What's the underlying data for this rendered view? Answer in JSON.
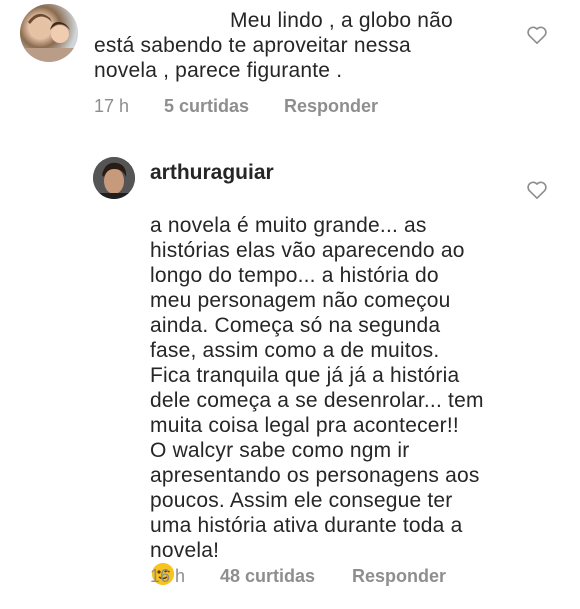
{
  "comments": [
    {
      "text": "Meu lindo , a globo não\nestá sabendo te aproveitar nessa\nnovela ,  parece figurante .",
      "time": "17 h",
      "likes": "5 curtidas",
      "reply": "Responder"
    },
    {
      "username": "arthuraguiar",
      "text": "a novela é muito grande... as\nhistórias elas vão aparecendo ao\nlongo do tempo... a história do\nmeu personagem não começou\nainda. Começa só na segunda\nfase, assim como a de muitos.\nFica tranquila que já já a história\ndele começa a se desenrolar... tem\nmuita coisa legal pra acontecer!!\nO walcyr sabe como ngm ir\napresentando os personagens aos\npoucos. Assim ele consegue ter\numa história ativa durante toda a\nnovela!",
      "time": "16 h",
      "likes": "48 curtidas",
      "reply": "Responder"
    }
  ],
  "colors": {
    "text": "#262626",
    "meta": "#8e8e8e",
    "heart_stroke": "#8e8e8e"
  },
  "icons": [
    "heart-outline-icon",
    "winking-face-emoji"
  ]
}
